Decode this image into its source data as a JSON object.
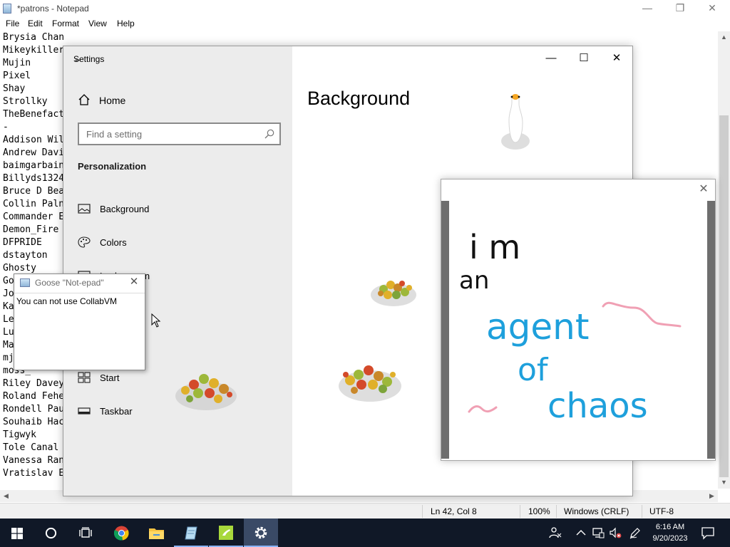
{
  "notepad": {
    "title": "*patrons - Notepad",
    "menu": [
      "File",
      "Edit",
      "Format",
      "View",
      "Help"
    ],
    "lines": [
      "Brysia Chan",
      "Mikeykiller",
      "Mujin",
      "Pixel",
      "Shay",
      "Strollky",
      "TheBenefact",
      "-",
      "Addison Wil",
      "Andrew Davi",
      "baimgarbain",
      "Billyds1324",
      "Bruce D Bea",
      "Collin Paln",
      "Commander E",
      "Demon_Fire",
      "DFPRIDE",
      "dstayton",
      "Ghosty",
      "Go",
      "Jo",
      "Ka",
      "Le",
      "Lu",
      "Ma",
      "mj",
      "moss_",
      "Riley Davey",
      "Roland Fehe",
      "Rondell Pau",
      "Souhaib Hac",
      "Tigwyk",
      "Tole Canal",
      "Vanessa Ran",
      "Vratislav E"
    ],
    "status": {
      "position": "Ln 42, Col 8",
      "zoom": "100%",
      "line_ending": "Windows (CRLF)",
      "encoding": "UTF-8"
    }
  },
  "settings": {
    "window_title": "Settings",
    "home_label": "Home",
    "search_placeholder": "Find a setting",
    "section": "Personalization",
    "nav": [
      {
        "label": "Background",
        "icon": "picture-icon"
      },
      {
        "label": "Colors",
        "icon": "palette-icon"
      },
      {
        "label": "Lock screen",
        "icon": "lock-screen-icon"
      },
      {
        "label": "Start",
        "icon": "start-icon"
      },
      {
        "label": "Taskbar",
        "icon": "taskbar-icon"
      }
    ],
    "page_title": "Background"
  },
  "drawing": {
    "words": [
      "i m",
      "an",
      "agent",
      "of",
      "chaos"
    ],
    "colors": {
      "black": "#111111",
      "blue": "#1ea0dc",
      "pink": "#f0a0b4"
    }
  },
  "popup": {
    "title": "Goose \"Not-epad\"",
    "message": "You can not use CollabVM"
  },
  "taskbar": {
    "items": [
      "start-icon",
      "cortana-icon",
      "task-view-icon",
      "chrome-icon",
      "file-explorer-icon",
      "notepad-icon",
      "goose-app-icon",
      "settings-gear-icon"
    ],
    "tray": [
      "people-icon",
      "chevron-up-icon",
      "network-icon",
      "volume-muted-icon",
      "pen-icon"
    ],
    "time": "6:16 AM",
    "date": "9/20/2023"
  }
}
